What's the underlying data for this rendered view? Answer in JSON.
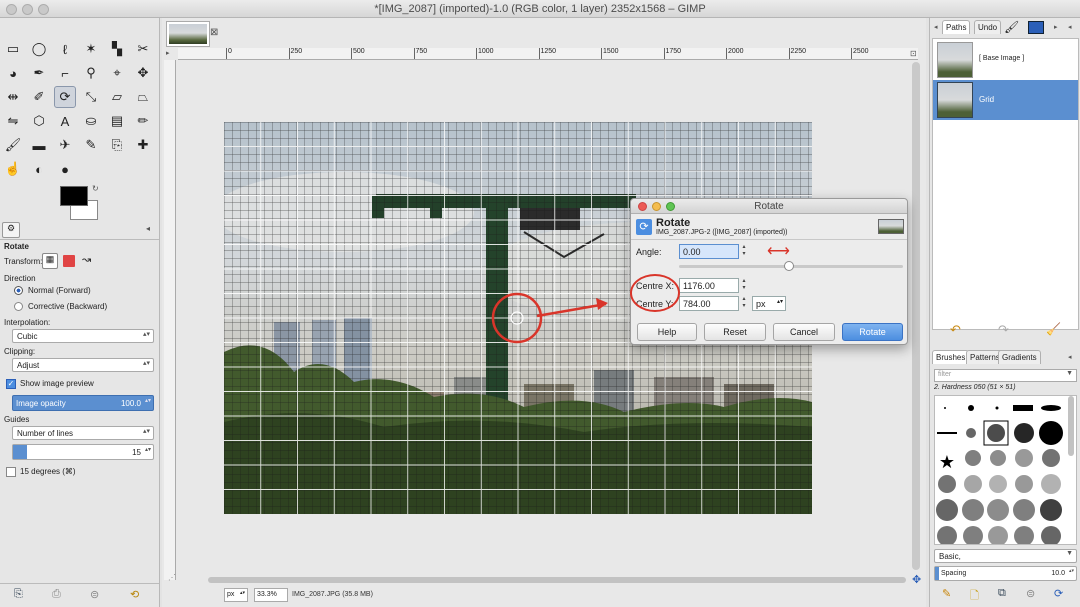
{
  "window": {
    "title": "*[IMG_2087] (imported)-1.0 (RGB color, 1 layer) 2352x1568 – GIMP"
  },
  "toolbox": {
    "tool_icons": [
      "rect-select-icon",
      "ellipse-select-icon",
      "lasso-icon",
      "fuzzy-select-icon",
      "color-select-icon",
      "scissors-icon",
      "foreground-select-icon",
      "paths-icon",
      "color-picker-icon",
      "zoom-icon",
      "measure-icon",
      "move-icon",
      "align-icon",
      "crop-icon",
      "rotate-icon",
      "scale-icon",
      "shear-icon",
      "perspective-icon",
      "flip-icon",
      "cage-icon",
      "text-icon",
      "bucket-fill-icon",
      "blend-icon",
      "pencil-icon",
      "paintbrush-icon",
      "eraser-icon",
      "airbrush-icon",
      "ink-icon",
      "clone-icon",
      "heal-icon",
      "smudge-icon",
      "blur-icon",
      "dodge-icon"
    ],
    "tool_options_title": "Rotate",
    "transform_label": "Transform:",
    "direction_label": "Direction",
    "direction_options": [
      "Normal (Forward)",
      "Corrective (Backward)"
    ],
    "interpolation_label": "Interpolation:",
    "interpolation_value": "Cubic",
    "clipping_label": "Clipping:",
    "clipping_value": "Adjust",
    "show_preview_label": "Show image preview",
    "image_opacity_label": "Image opacity",
    "image_opacity_value": "100.0",
    "guides_label": "Guides",
    "guides_value": "Number of lines",
    "lines_value": "15",
    "fifteen_degrees_label": "15 degrees  (⌘)"
  },
  "canvas": {
    "ruler_labels": [
      "0",
      "250",
      "500",
      "750",
      "1000",
      "1250",
      "1500",
      "1750",
      "2000",
      "2250",
      "2500"
    ],
    "status_unit": "px",
    "status_zoom": "33.3%",
    "status_file": "IMG_2087.JPG (35.8 MB)"
  },
  "layers": {
    "tabs": [
      "Paths",
      "Undo"
    ],
    "items": [
      "[ Base Image ]",
      "Grid"
    ]
  },
  "brushes": {
    "tabs": [
      "Brushes",
      "Patterns",
      "Gradients"
    ],
    "filter_placeholder": "filter",
    "current_brush": "2. Hardness 050 (51 × 51)",
    "preset": "Basic,",
    "spacing_label": "Spacing",
    "spacing_value": "10.0"
  },
  "rotate_dialog": {
    "window_title": "Rotate",
    "header": "Rotate",
    "subheader": "IMG_2087.JPG-2 ([IMG_2087] (imported))",
    "angle_label": "Angle:",
    "angle_value": "0.00",
    "center_x_label": "Centre X:",
    "center_x_value": "1176.00",
    "center_y_label": "Centre Y:",
    "center_y_value": "784.00",
    "unit": "px",
    "buttons": [
      "Help",
      "Reset",
      "Cancel",
      "Rotate"
    ]
  },
  "colors": {
    "accent": "#4c8ee0",
    "annotation": "#d9352a",
    "selection": "#5b8fd0"
  }
}
